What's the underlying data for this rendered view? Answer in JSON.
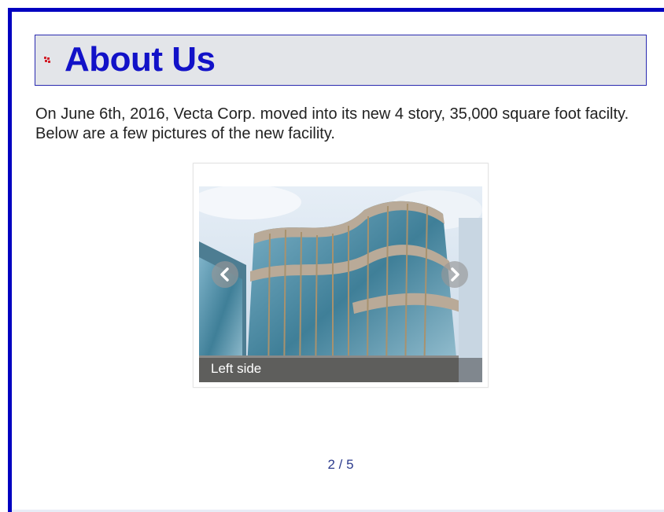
{
  "header": {
    "title": "About Us",
    "bullet_icon": "bullet-icon"
  },
  "intro": {
    "text": "On June 6th, 2016, Vecta Corp. moved into its new 4 story, 35,000 square foot facilty. Below are a few pictures of the new facility."
  },
  "carousel": {
    "caption": "Left side",
    "current": 2,
    "total": 5,
    "counter": "2 / 5",
    "prev_icon": "chevron-left-icon",
    "next_icon": "chevron-right-icon"
  },
  "colors": {
    "frame_border": "#0000c0",
    "title": "#1212c8",
    "heading_bg": "#e3e5e9",
    "counter": "#2b3a8c"
  }
}
